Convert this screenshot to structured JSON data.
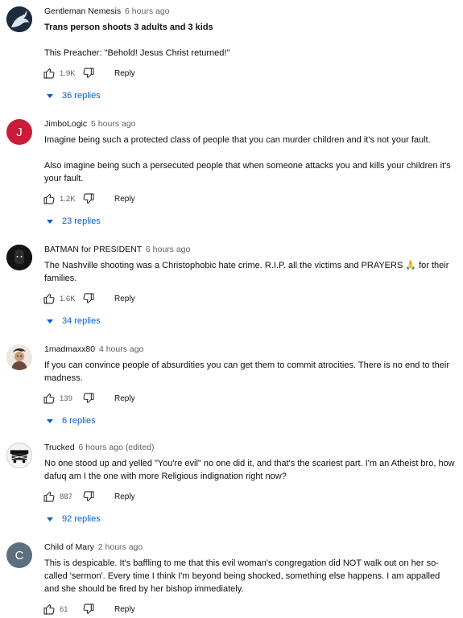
{
  "colors": {
    "link_blue": "#065fd4",
    "muted": "#606060",
    "avatar_red": "#cc1b3a",
    "avatar_slate": "#5b6f7f"
  },
  "comments": [
    {
      "author": "Gentleman Nemesis",
      "time": "6 hours ago",
      "avatar_icon": "dragon-avatar-icon",
      "lines": [
        "Trans person shoots 3 adults and 3 kids",
        "This Preacher: \"Behold! Jesus Christ returned!\""
      ],
      "likes": "1.9K",
      "reply_label": "Reply",
      "replies": "36 replies"
    },
    {
      "author": "JimboLogic",
      "time": "5 hours ago",
      "avatar_letter": "J",
      "lines": [
        "Imagine being such a protected class of people that you can murder children and it's not your fault.",
        "Also imagine being such a persecuted people that when someone attacks you and kills your children it's your fault."
      ],
      "likes": "1.2K",
      "reply_label": "Reply",
      "replies": "23 replies"
    },
    {
      "author": "BATMAN for PRESIDENT",
      "time": "6 hours ago",
      "avatar_icon": "bat-avatar-icon",
      "lines": [
        "The Nashville shooting was a Christophobic hate crime.  R.I.P. all the victims and PRAYERS 🙏 for their families."
      ],
      "likes": "1.6K",
      "reply_label": "Reply",
      "replies": "34 replies"
    },
    {
      "author": "1madmaxx80",
      "time": "4 hours ago",
      "avatar_icon": "character-avatar-icon",
      "lines": [
        "If you can convince people of absurdities you can get them to commit atrocities. There is no end to their madness."
      ],
      "likes": "139",
      "reply_label": "Reply",
      "replies": "6 replies"
    },
    {
      "author": "Trucked",
      "time": "6 hours ago (edited)",
      "avatar_icon": "truck-avatar-icon",
      "lines": [
        "No one stood up and yelled \"You're evil\" no one did it, and that's the scariest part. I'm an Atheist bro, how dafuq am I the one with more Religious indignation right now?"
      ],
      "likes": "887",
      "reply_label": "Reply",
      "replies": "92 replies"
    },
    {
      "author": "Child of Mary",
      "time": "2 hours ago",
      "avatar_letter": "C",
      "lines": [
        "This is despicable. It's baffling to me that this evil woman's congregation did NOT walk out on her so-called 'sermon'. Every time I think I'm beyond being shocked, something else happens. I am appalled and she should be fired by her bishop immediately."
      ],
      "likes": "61",
      "reply_label": "Reply"
    }
  ]
}
